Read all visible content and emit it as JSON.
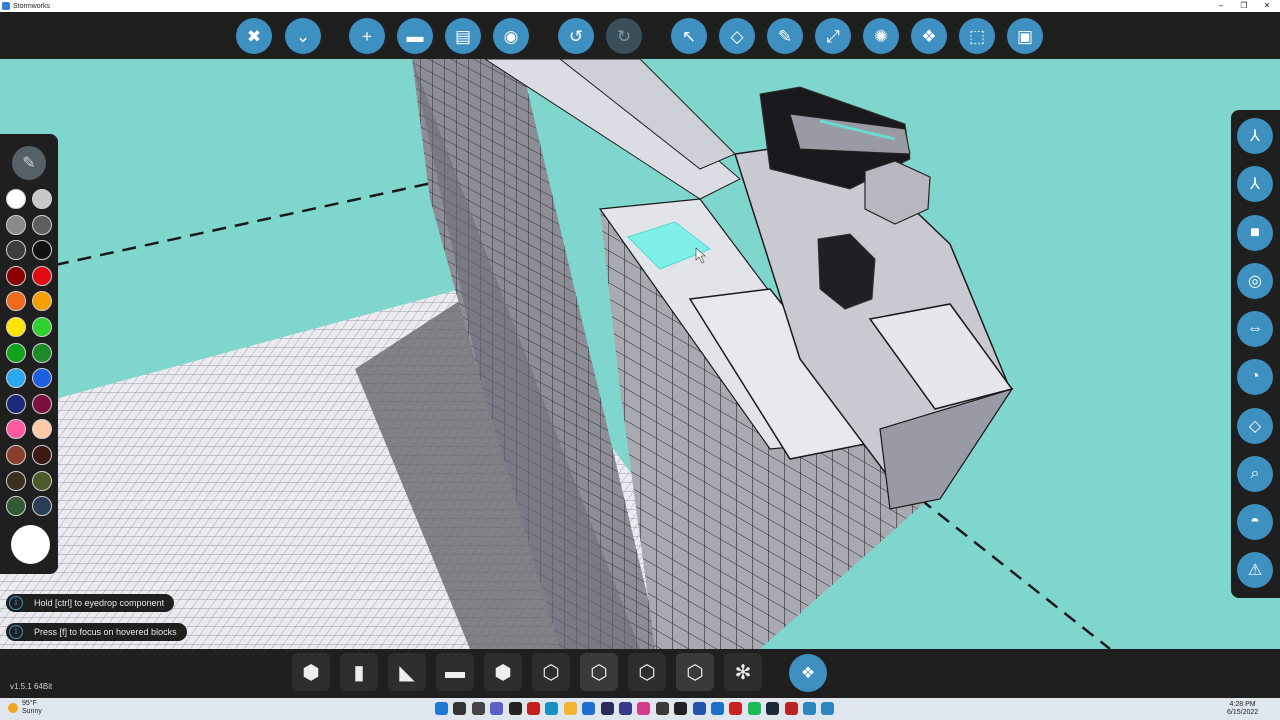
{
  "window": {
    "title": "Stormworks",
    "minimize": "–",
    "restore": "❐",
    "close": "✕"
  },
  "toolbar": {
    "buttons": [
      {
        "name": "close-editor-button",
        "icon": "close-x-icon",
        "glyph": "✖"
      },
      {
        "name": "dropdown-menu-button",
        "icon": "dropdown-icon",
        "glyph": "⌄"
      },
      {
        "name": "new-vehicle-button",
        "icon": "plus-icon",
        "glyph": "+"
      },
      {
        "name": "open-folder-button",
        "icon": "folder-icon",
        "glyph": "▬"
      },
      {
        "name": "save-button",
        "icon": "save-disk-icon",
        "glyph": "▤"
      },
      {
        "name": "steam-workshop-button",
        "icon": "steam-icon",
        "glyph": "◉"
      },
      {
        "name": "undo-button",
        "icon": "undo-icon",
        "glyph": "↺"
      },
      {
        "name": "redo-button",
        "icon": "redo-icon",
        "glyph": "↻"
      },
      {
        "name": "select-tool-button",
        "icon": "arrow-cursor-icon",
        "glyph": "↖"
      },
      {
        "name": "erase-tool-button",
        "icon": "eraser-icon",
        "glyph": "◇"
      },
      {
        "name": "paint-tool-button",
        "icon": "paint-brush-icon",
        "glyph": "✎"
      },
      {
        "name": "transform-tool-button",
        "icon": "axes-icon",
        "glyph": "⤢"
      },
      {
        "name": "lighting-button",
        "icon": "light-bulb-icon",
        "glyph": "✺"
      },
      {
        "name": "logic-view-button",
        "icon": "blocks-icon",
        "glyph": "❖"
      },
      {
        "name": "selection-box-button",
        "icon": "selection-box-icon",
        "glyph": "⬚"
      },
      {
        "name": "microcontroller-button",
        "icon": "chip-icon",
        "glyph": "▣"
      }
    ]
  },
  "palette": {
    "brush_icon": "✎",
    "colors": [
      "#ffffff",
      "#c8c8c8",
      "#8a8a8a",
      "#5e5e5e",
      "#3c3c3c",
      "#111111",
      "#8b0000",
      "#e10b16",
      "#f06a1b",
      "#f5a000",
      "#ffe600",
      "#2fd12f",
      "#12a11b",
      "#1f8a2a",
      "#2aa7f0",
      "#1c5fe0",
      "#1b2a7a",
      "#7a1040",
      "#ff5aa0",
      "#ffcaa8",
      "#8a3f2a",
      "#3a1a12",
      "#3b2f1e",
      "#4a5a2a",
      "#2f5a33",
      "#2a3f55"
    ],
    "current_color": "#ffffff"
  },
  "hints": [
    {
      "icon": "i",
      "text": "Hold [ctrl] to eyedrop component"
    },
    {
      "icon": "i",
      "text": "Press [f] to focus on hovered blocks"
    }
  ],
  "right_panel": {
    "buttons": [
      {
        "name": "view-top-button",
        "icon": "axis-view-icon",
        "glyph": "⅄"
      },
      {
        "name": "view-side-button",
        "icon": "axis-view-alt-icon",
        "glyph": "⅄"
      },
      {
        "name": "camera-button",
        "icon": "camera-icon",
        "glyph": "■"
      },
      {
        "name": "center-of-mass-button",
        "icon": "target-ring-icon",
        "glyph": "◎"
      },
      {
        "name": "merge-button",
        "icon": "merge-arrows-icon",
        "glyph": "⇔"
      },
      {
        "name": "rotate-button",
        "icon": "rotate-icon",
        "glyph": "◔"
      },
      {
        "name": "block-view-button",
        "icon": "cube-outline-icon",
        "glyph": "◇"
      },
      {
        "name": "search-component-button",
        "icon": "search-magnifier-icon",
        "glyph": "⌕"
      },
      {
        "name": "stats-button",
        "icon": "gauge-icon",
        "glyph": "◓"
      },
      {
        "name": "warnings-button",
        "icon": "warning-triangle-icon",
        "glyph": "⚠"
      }
    ]
  },
  "bottom_bar": {
    "version": "v1.5.1 64Bit",
    "components": [
      {
        "name": "component-block",
        "icon": "cube-block-icon",
        "glyph": "⬢"
      },
      {
        "name": "component-pipe",
        "icon": "cylinder-icon",
        "glyph": "▮"
      },
      {
        "name": "component-wedge-small",
        "icon": "wedge-icon",
        "glyph": "◣"
      },
      {
        "name": "component-rod",
        "icon": "rod-icon",
        "glyph": "▬"
      },
      {
        "name": "component-slab",
        "icon": "slab-icon",
        "glyph": "⬢"
      },
      {
        "name": "component-cube-outline",
        "icon": "cube-outline-icon",
        "glyph": "⬡"
      },
      {
        "name": "component-frame",
        "icon": "frame-cube-icon",
        "glyph": "⬡"
      },
      {
        "name": "component-cage",
        "icon": "cage-cube-icon",
        "glyph": "⬡"
      },
      {
        "name": "component-hull",
        "icon": "hull-cube-icon",
        "glyph": "⬡"
      },
      {
        "name": "component-fan",
        "icon": "fan-icon",
        "glyph": "✻"
      }
    ],
    "add_glyph": "❖"
  },
  "taskbar": {
    "weather_temp": "95°F",
    "weather_desc": "Sunny",
    "time": "4:28 PM",
    "date": "6/15/2022",
    "icons": [
      {
        "name": "start-button",
        "icon": "windows-logo-icon",
        "color": "#1e78d6"
      },
      {
        "name": "taskbar-search",
        "icon": "search-icon",
        "color": "#333333"
      },
      {
        "name": "taskbar-task-view",
        "icon": "task-view-icon",
        "color": "#444444"
      },
      {
        "name": "taskbar-chat",
        "icon": "chat-icon",
        "color": "#5b5fc7"
      },
      {
        "name": "taskbar-app-1",
        "icon": "app-icon",
        "color": "#222222"
      },
      {
        "name": "taskbar-app-2",
        "icon": "app-icon",
        "color": "#c41e1e"
      },
      {
        "name": "taskbar-edge",
        "icon": "edge-icon",
        "color": "#1a8fc1"
      },
      {
        "name": "taskbar-explorer",
        "icon": "folder-icon",
        "color": "#f2b530"
      },
      {
        "name": "taskbar-app-3",
        "icon": "app-icon",
        "color": "#1b6fd1"
      },
      {
        "name": "taskbar-app-4",
        "icon": "app-icon",
        "color": "#2b2b5a"
      },
      {
        "name": "taskbar-app-5",
        "icon": "app-icon",
        "color": "#3a3a8a"
      },
      {
        "name": "taskbar-app-6",
        "icon": "app-icon",
        "color": "#d43b8a"
      },
      {
        "name": "taskbar-app-7",
        "icon": "app-icon",
        "color": "#3a3a3a"
      },
      {
        "name": "taskbar-amazon",
        "icon": "amazon-icon",
        "color": "#222222"
      },
      {
        "name": "taskbar-app-8",
        "icon": "app-icon",
        "color": "#2255aa"
      },
      {
        "name": "taskbar-app-9",
        "icon": "app-icon",
        "color": "#1a73c8"
      },
      {
        "name": "taskbar-app-10",
        "icon": "app-icon",
        "color": "#c92222"
      },
      {
        "name": "taskbar-spotify",
        "icon": "spotify-icon",
        "color": "#1db954"
      },
      {
        "name": "taskbar-steam",
        "icon": "steam-icon",
        "color": "#1b2838"
      },
      {
        "name": "taskbar-app-11",
        "icon": "app-icon",
        "color": "#b22"
      },
      {
        "name": "taskbar-stormworks",
        "icon": "stormworks-icon",
        "color": "#2e86c1"
      },
      {
        "name": "taskbar-app-12",
        "icon": "app-icon",
        "color": "#2e86c1"
      }
    ]
  },
  "colors": {
    "accent": "#3d90c0",
    "panel": "#1f1f1f",
    "sky": "#7fd6cc",
    "highlight": "#7ff0e8"
  }
}
